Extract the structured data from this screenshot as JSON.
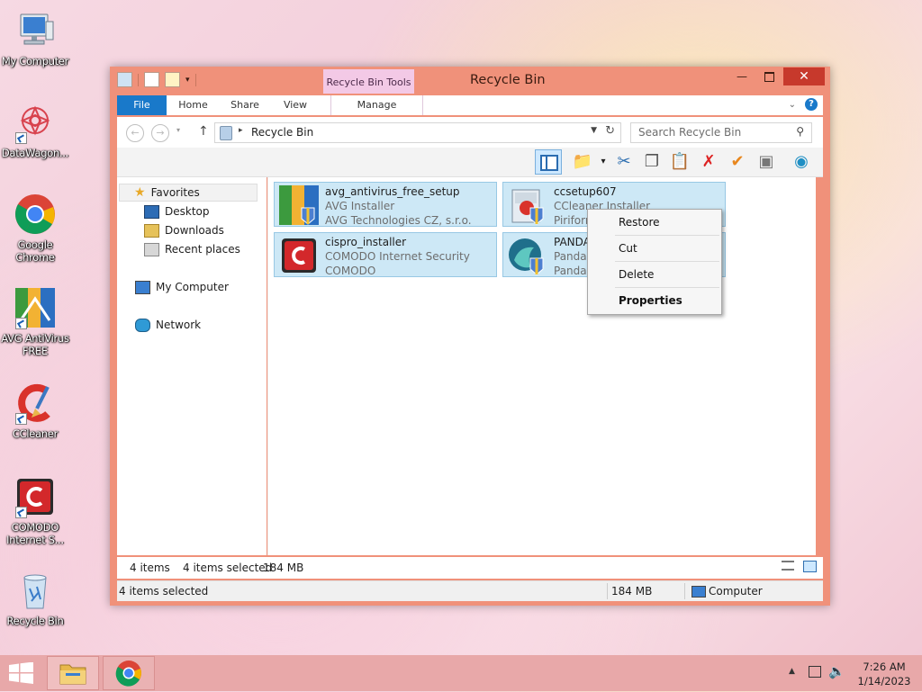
{
  "desktop": {
    "icons": [
      {
        "label": "My Computer"
      },
      {
        "label": "DataWagon..."
      },
      {
        "label": "Google\nChrome"
      },
      {
        "label": "AVG AntiVirus\nFREE"
      },
      {
        "label": "CCleaner"
      },
      {
        "label": "COMODO\nInternet S..."
      },
      {
        "label": "Recycle Bin"
      }
    ]
  },
  "window": {
    "title": "Recycle Bin",
    "tool_tab_header": "Recycle Bin Tools",
    "ribbon_tabs": [
      {
        "label": "File"
      },
      {
        "label": "Home"
      },
      {
        "label": "Share"
      },
      {
        "label": "View"
      },
      {
        "label": "Manage"
      }
    ],
    "address": {
      "path": "Recycle Bin",
      "search_placeholder": "Search Recycle Bin"
    },
    "nav_pane": {
      "favorites": "Favorites",
      "desktop": "Desktop",
      "downloads": "Downloads",
      "recent": "Recent places",
      "my_computer": "My Computer",
      "network": "Network"
    },
    "items": [
      {
        "name": "avg_antivirus_free_setup",
        "desc": "AVG Installer",
        "company": "AVG Technologies CZ, s.r.o."
      },
      {
        "name": "ccsetup607",
        "desc": "CCleaner Installer",
        "company": "Piriform"
      },
      {
        "name": "cispro_installer",
        "desc": "COMODO Internet Security",
        "company": "COMODO"
      },
      {
        "name": "PANDA",
        "desc": "Panda",
        "company": "Panda"
      }
    ],
    "status_top": {
      "count": "4 items",
      "selected": "4 items selected",
      "size": "184 MB"
    },
    "status_bottom": {
      "selected": "4 items selected",
      "size": "184 MB",
      "location": "Computer"
    }
  },
  "context_menu": {
    "restore": "Restore",
    "cut": "Cut",
    "delete": "Delete",
    "properties": "Properties"
  },
  "taskbar": {
    "time": "7:26 AM",
    "date": "1/14/2023"
  },
  "colors": {
    "window_frame": "#f0917a",
    "close_button": "#c7392c",
    "file_tab": "#1979ca",
    "selection_fill": "#cde8f6",
    "selection_border": "#98c8e4",
    "taskbar": "#e8a8a9"
  }
}
